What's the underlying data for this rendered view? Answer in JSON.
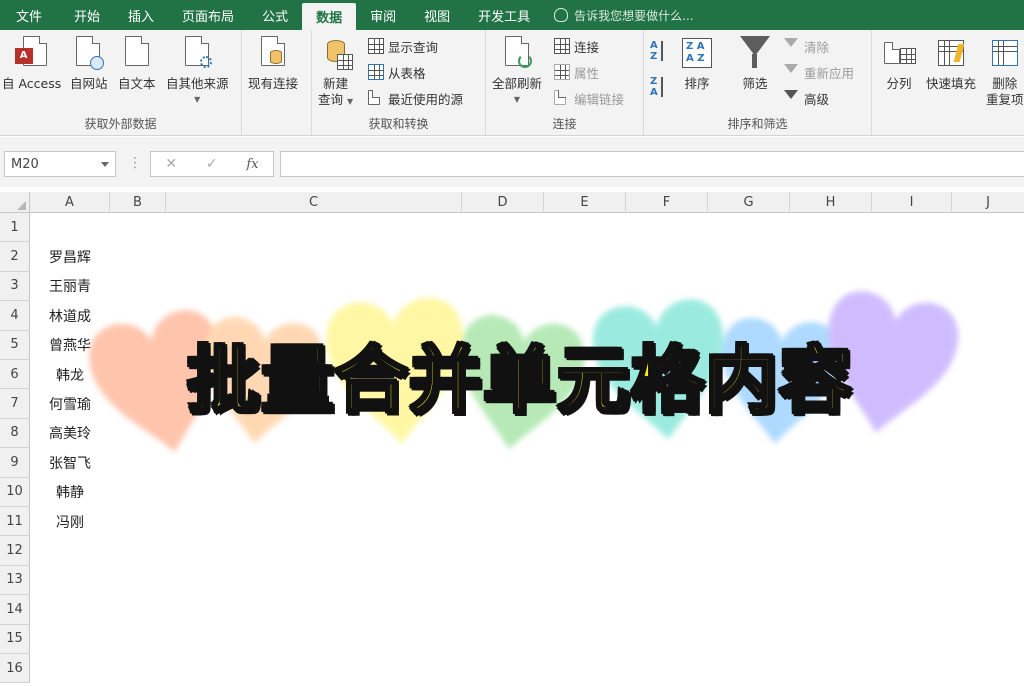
{
  "tabs": {
    "file": "文件",
    "home": "开始",
    "insert": "插入",
    "page_layout": "页面布局",
    "formulas": "公式",
    "data": "数据",
    "review": "审阅",
    "view": "视图",
    "developer": "开发工具",
    "tell_me": "告诉我您想要做什么..."
  },
  "ribbon": {
    "get_external": {
      "label": "获取外部数据",
      "from_access": "自 Access",
      "from_web": "自网站",
      "from_text": "自文本",
      "from_other": "自其他来源"
    },
    "existing_connections": "现有连接",
    "get_transform": {
      "label": "获取和转换",
      "new_query_line1": "新建",
      "new_query_line2": "查询",
      "show_queries": "显示查询",
      "from_table": "从表格",
      "recent_sources": "最近使用的源"
    },
    "connections": {
      "label": "连接",
      "refresh_all": "全部刷新",
      "connections": "连接",
      "properties": "属性",
      "edit_links": "编辑链接"
    },
    "sort_filter": {
      "label": "排序和筛选",
      "sort": "排序",
      "filter": "筛选",
      "clear": "清除",
      "reapply": "重新应用",
      "advanced": "高级"
    },
    "data_tools": {
      "text_to_columns": "分列",
      "flash_fill": "快速填充",
      "remove_dup_line1": "删除",
      "remove_dup_line2": "重复项"
    }
  },
  "formula_bar": {
    "name_box": "M20",
    "cancel": "✕",
    "enter": "✓",
    "fx": "fx",
    "dots": "⋮",
    "value": ""
  },
  "columns": [
    "A",
    "B",
    "C",
    "D",
    "E",
    "F",
    "G",
    "H",
    "I",
    "J"
  ],
  "rows": [
    "1",
    "2",
    "3",
    "4",
    "5",
    "6",
    "7",
    "8",
    "9",
    "10",
    "11",
    "12",
    "13",
    "14",
    "15",
    "16"
  ],
  "cells_a": [
    "",
    "罗昌辉",
    "王丽青",
    "林道成",
    "曾燕华",
    "韩龙",
    "何雪瑜",
    "高美玲",
    "张智飞",
    "韩静",
    "冯刚",
    "",
    "",
    "",
    "",
    ""
  ],
  "overlay_title": "批量合并单元格内容"
}
